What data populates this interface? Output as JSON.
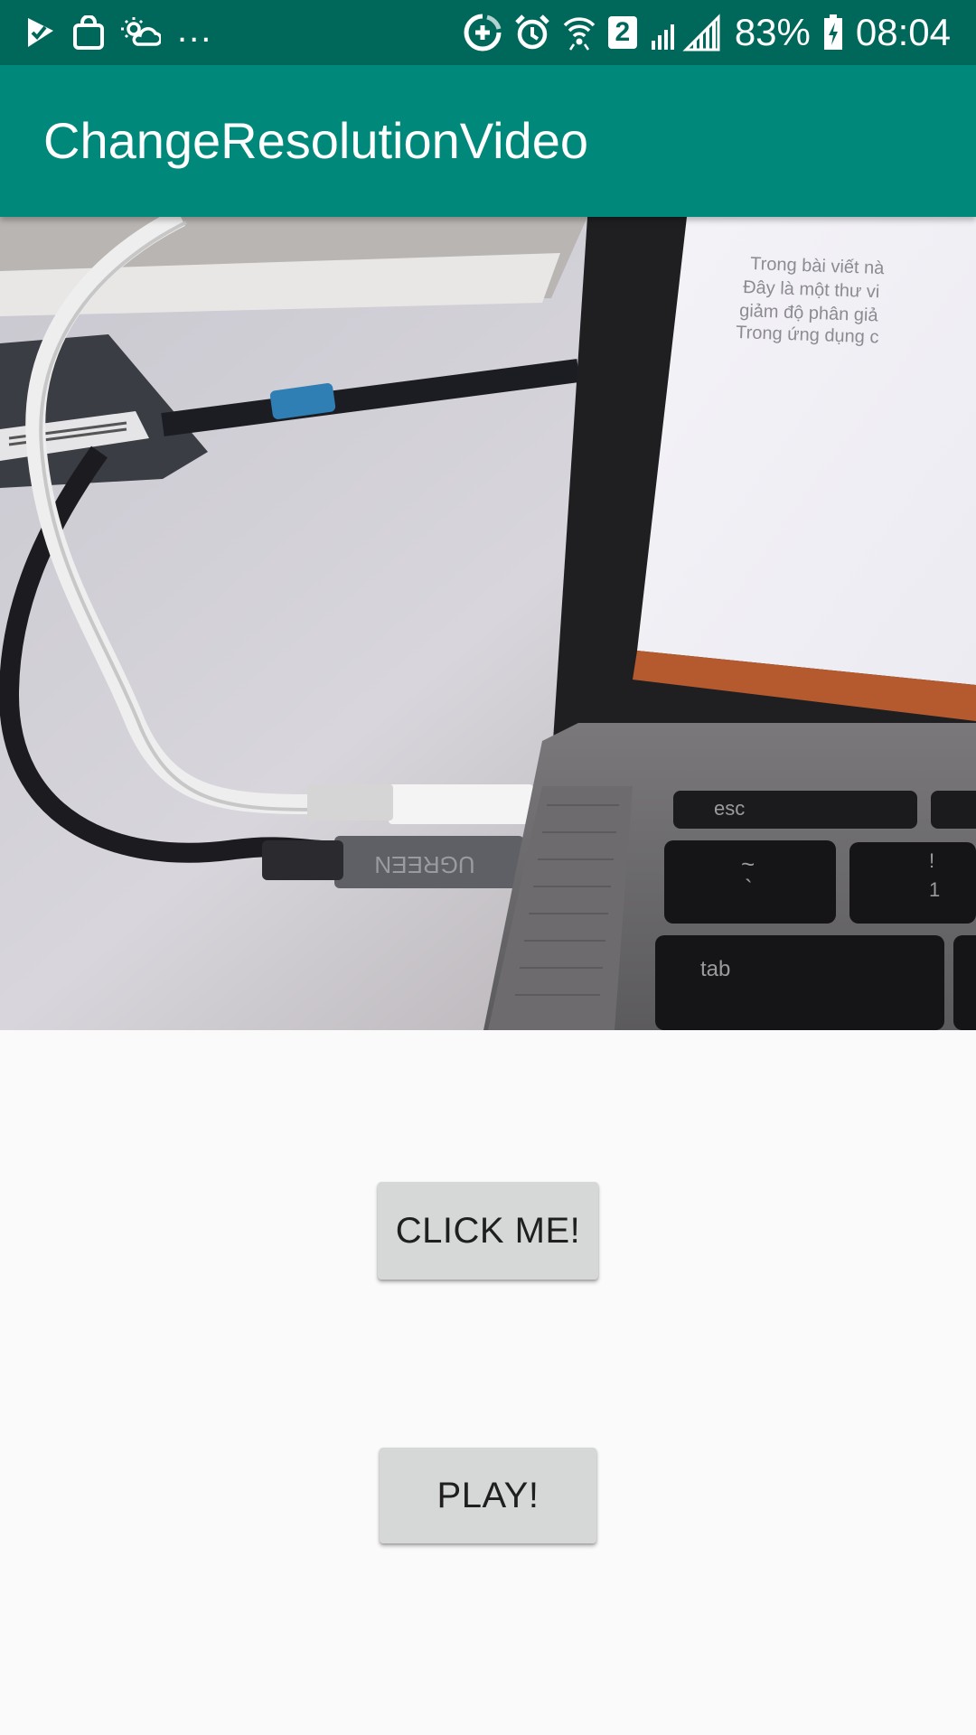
{
  "status_bar": {
    "left_icons": [
      "check-flag-icon",
      "shopping-bag-icon",
      "weather-cloud-icon"
    ],
    "overflow": "...",
    "right_icons": [
      "data-saver-icon",
      "alarm-icon",
      "wifi-icon",
      "sim2-icon",
      "signal-icon",
      "battery-charging-icon"
    ],
    "sim_number": "2",
    "battery": "83%",
    "time": "08:04"
  },
  "app_bar": {
    "title": "ChangeResolutionVideo",
    "color": "#00897b"
  },
  "video": {
    "description_icon": "video-frame",
    "screen_text": [
      "Trong bài viết nà",
      "Đây là một thư vi",
      "giảm độ phân giả",
      "Trong ứng dụng c"
    ],
    "keys": [
      "esc",
      "tab",
      "~",
      "!",
      "`",
      "1"
    ],
    "cable_brand": "UGREEN"
  },
  "buttons": {
    "click_me": "CLICK ME!",
    "play": "PLAY!"
  },
  "colors": {
    "status_bar": "#00675b",
    "app_bar": "#00897b",
    "button_bg": "#d6d7d7",
    "background": "#fafafa"
  }
}
